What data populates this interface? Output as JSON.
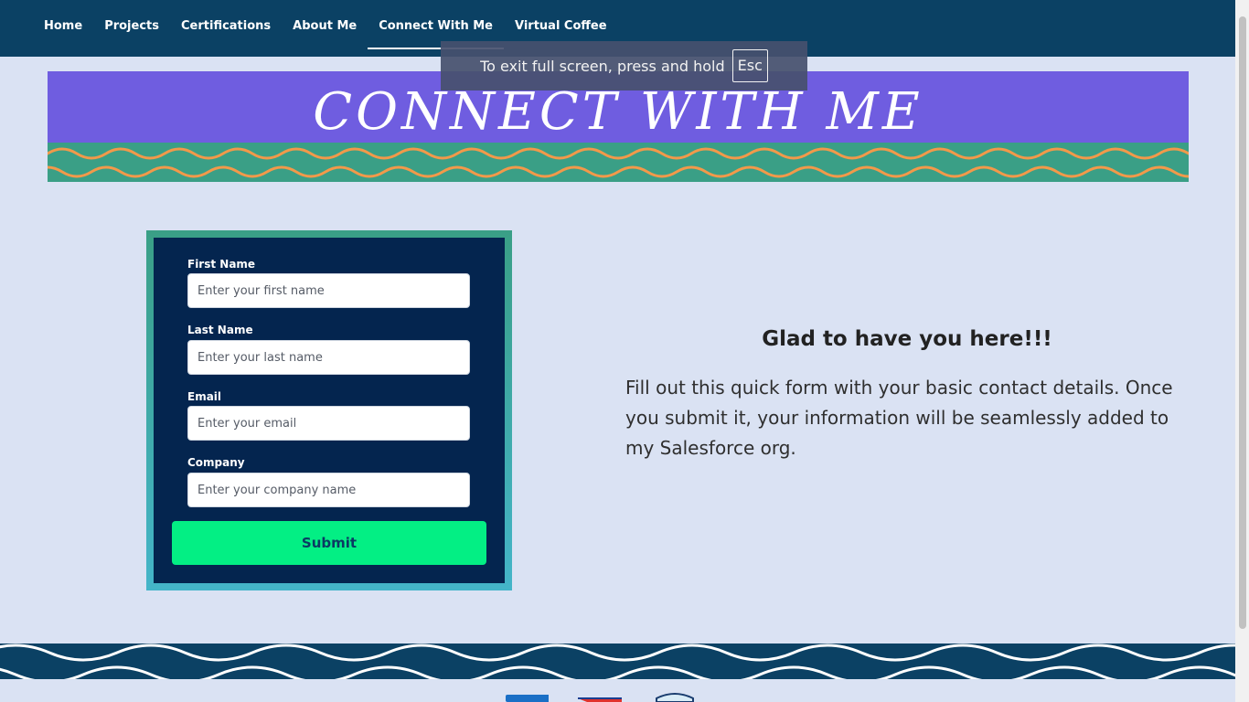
{
  "nav": {
    "items": [
      {
        "label": "Home"
      },
      {
        "label": "Projects"
      },
      {
        "label": "Certifications"
      },
      {
        "label": "About Me"
      },
      {
        "label": "Connect With Me"
      },
      {
        "label": "Virtual Coffee"
      }
    ],
    "active": "Connect With Me"
  },
  "fullscreen_notice": {
    "text": "To exit full screen, press and hold",
    "key": "Esc"
  },
  "banner": {
    "title": "CONNECT WITH ME"
  },
  "form": {
    "fields": [
      {
        "label": "First Name",
        "placeholder": "Enter your first name",
        "value": ""
      },
      {
        "label": "Last Name",
        "placeholder": "Enter your last name",
        "value": ""
      },
      {
        "label": "Email",
        "placeholder": "Enter your email",
        "value": ""
      },
      {
        "label": "Company",
        "placeholder": "Enter your company name",
        "value": ""
      }
    ],
    "submit_label": "Submit"
  },
  "intro": {
    "heading": "Glad to have you here!!!",
    "text": "Fill out this quick form with your basic contact details. Once you submit it, your information will be seamlessly added to my Salesforce org."
  },
  "colors": {
    "nav_bg": "#0b4164",
    "page_bg": "#dae2f3",
    "banner_bg": "#6f5de0",
    "banner_wave_bg": "#3a9f86",
    "banner_wave_line": "#f2994a",
    "form_bg": "#04254f",
    "submit_bg": "#03ef84"
  }
}
